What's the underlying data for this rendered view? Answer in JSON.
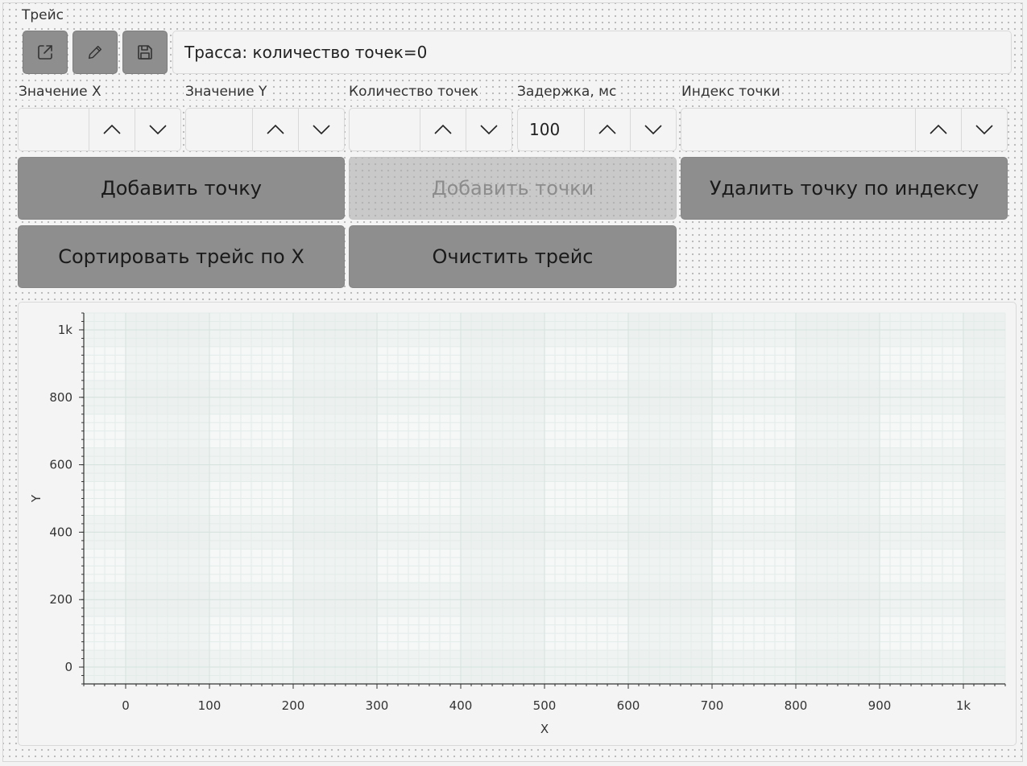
{
  "trace": {
    "title": "Трейс",
    "field_text": "Трасса: количество точек=0",
    "toolbar": {
      "open_icon": "open-external-icon",
      "edit_icon": "pencil-icon",
      "save_icon": "floppy-disk-icon"
    }
  },
  "inputs": {
    "x_label": "Значение X",
    "x_value": "",
    "y_label": "Значение Y",
    "y_value": "",
    "count_label": "Количество точек",
    "count_value": "",
    "delay_label": "Задержка, мс",
    "delay_value": "100",
    "index_label": "Индекс точки",
    "index_value": ""
  },
  "buttons": {
    "add_point": "Добавить точку",
    "add_points": "Добавить точки",
    "delete_by_index": "Удалить точку по индексу",
    "sort_by_x": "Сортировать трейс по X",
    "clear_trace": "Очистить трейс"
  },
  "chart_data": {
    "type": "scatter",
    "series": [],
    "xlabel": "X",
    "ylabel": "Y",
    "xlim": [
      -50,
      1050
    ],
    "ylim": [
      -50,
      1050
    ],
    "x_ticks": [
      "0",
      "100",
      "200",
      "300",
      "400",
      "500",
      "600",
      "700",
      "800",
      "900",
      "1k"
    ],
    "y_ticks": [
      "0",
      "200",
      "400",
      "600",
      "800",
      "1k"
    ],
    "grid": true,
    "colors": {
      "plot_bg": "#f5f8f7",
      "band": "#e9eeed",
      "grid_major": "#d5e2df",
      "grid_minor": "#e4ecea"
    }
  }
}
